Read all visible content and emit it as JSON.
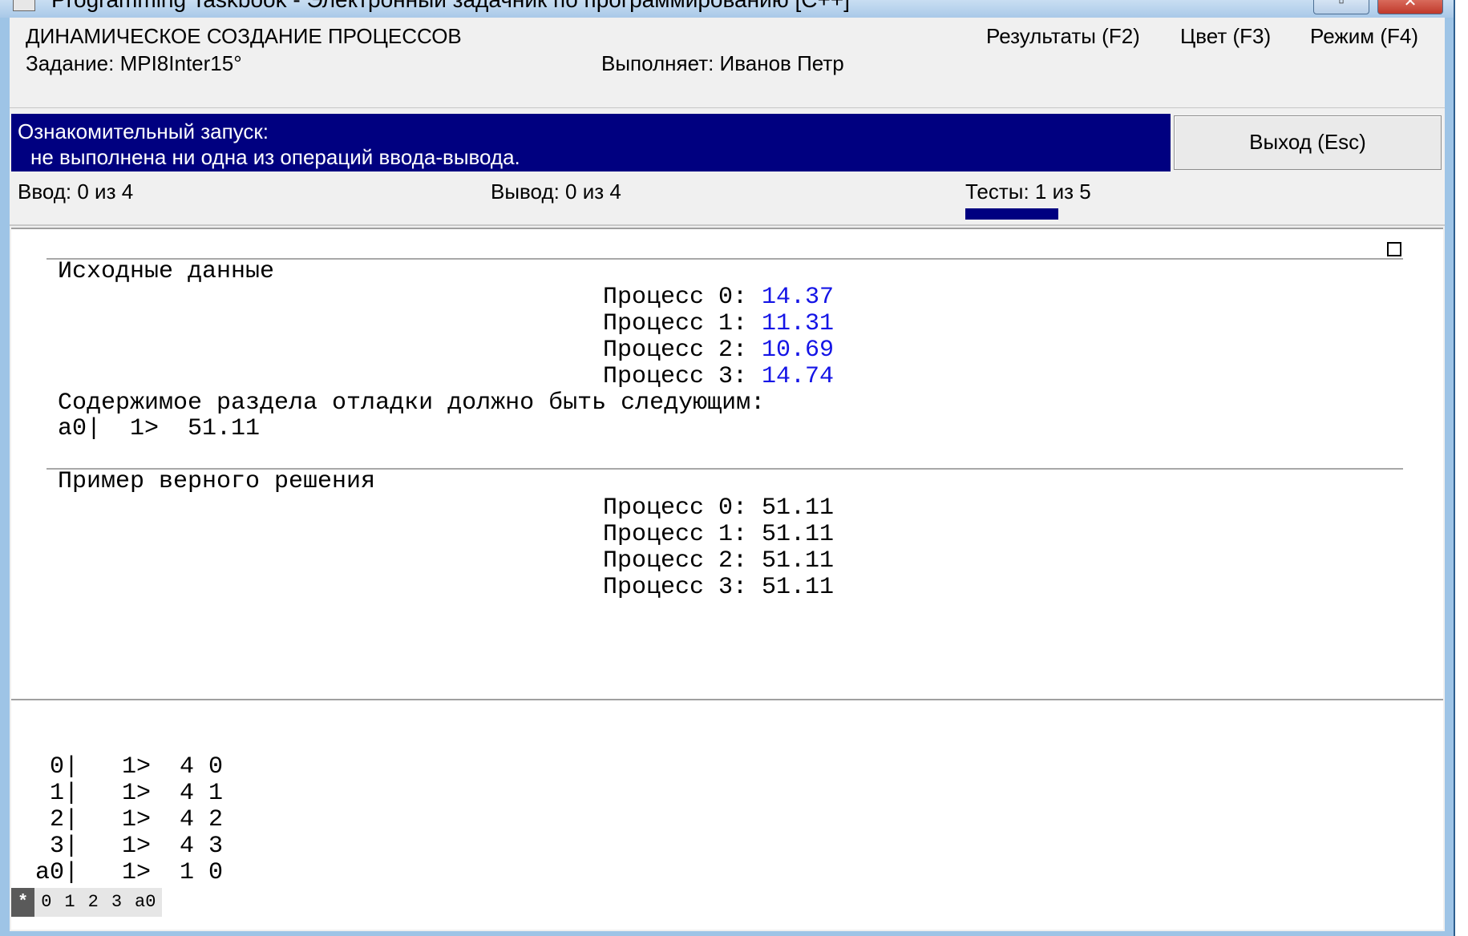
{
  "window": {
    "title": "Programming Taskbook - Электронный задачник по программированию [C++]",
    "min_glyph": "▫",
    "close_glyph": "✕"
  },
  "header": {
    "title": "ДИНАМИЧЕСКОЕ СОЗДАНИЕ ПРОЦЕССОВ",
    "task": "Задание: MPI8Inter15°",
    "user": "Выполняет: Иванов Петр",
    "menu": {
      "results": "Результаты (F2)",
      "color": "Цвет (F3)",
      "mode": "Режим (F4)"
    }
  },
  "status": {
    "line1": "Ознакомительный запуск:",
    "line2": "не выполнена ни одна из операций ввода-вывода.",
    "exit_label": "Выход (Esc)"
  },
  "counters": {
    "input": "Ввод: 0 из 4",
    "output": "Вывод: 0 из 4",
    "tests": "Тесты: 1 из 5",
    "tests_fraction": 0.2
  },
  "source_section": {
    "label": "Исходные данные",
    "rows": [
      {
        "label": "Процесс 0:",
        "value": "14.37"
      },
      {
        "label": "Процесс 1:",
        "value": "11.31"
      },
      {
        "label": "Процесс 2:",
        "value": "10.69"
      },
      {
        "label": "Процесс 3:",
        "value": "14.74"
      }
    ],
    "debug_note": "Содержимое раздела отладки должно быть следующим:",
    "debug_line": "a0|  1>  51.11"
  },
  "sample_section": {
    "label": "Пример верного решения",
    "rows": [
      {
        "label": "Процесс 0:",
        "value": "51.11"
      },
      {
        "label": "Процесс 1:",
        "value": "51.11"
      },
      {
        "label": "Процесс 2:",
        "value": "51.11"
      },
      {
        "label": "Процесс 3:",
        "value": "51.11"
      }
    ]
  },
  "console": {
    "lines": [
      " 0|   1>  4 0",
      " 1|   1>  4 1",
      " 2|   1>  4 2",
      " 3|   1>  4 3",
      "a0|   1>  1 0"
    ],
    "tabs": [
      "*",
      "0",
      "1",
      "2",
      "3",
      "a0"
    ]
  },
  "colors": {
    "status_bg": "#000080",
    "value_blue": "#1414e6"
  }
}
